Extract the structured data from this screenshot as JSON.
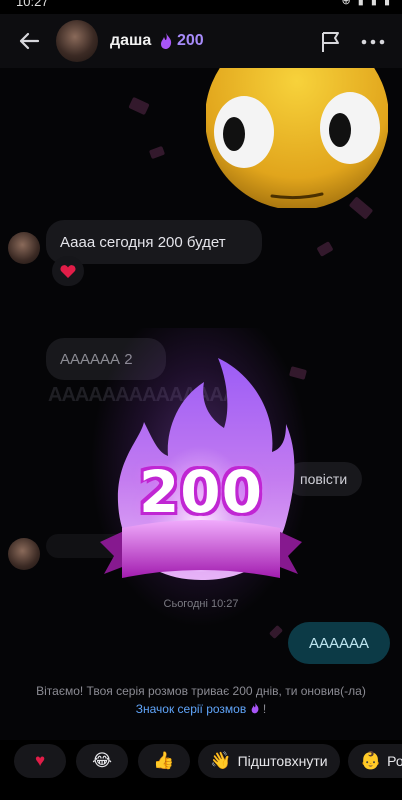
{
  "status_bar": {
    "time": "10:27",
    "icons": "⊕ ▮ ▮ ▮"
  },
  "header": {
    "name": "даша",
    "streak_count": "200"
  },
  "messages": {
    "incoming_1": "Аааа сегодня 200 будет",
    "incoming_1_reaction": "heart",
    "incoming_2": "АААААА 2",
    "story_reply": "повісти",
    "spam_text": "АААААААААААААААААААААААААААААААААААААААААААААААААААААААААААААААААААААААА",
    "timestamp": "Сьогодні 10:27",
    "outgoing_1": "АААААА",
    "system_text_1": "Вітаємо! Твоя серія розмов триває 200 днів, ти оновив(-ла)",
    "system_link": "Значок серії розмов",
    "system_text_2": "!"
  },
  "badge": {
    "number": "200"
  },
  "quick_reactions": {
    "heart": "♥",
    "laugh": "😂",
    "thumbs_up": "👍",
    "nudge_icon": "👋",
    "nudge_label": "Підштовхнути",
    "next_icon": "👶",
    "next_label": "Ро"
  },
  "colors": {
    "accent_purple": "#a78bfa",
    "bubble_out": "#0c3a46",
    "link": "#60a5fa"
  }
}
